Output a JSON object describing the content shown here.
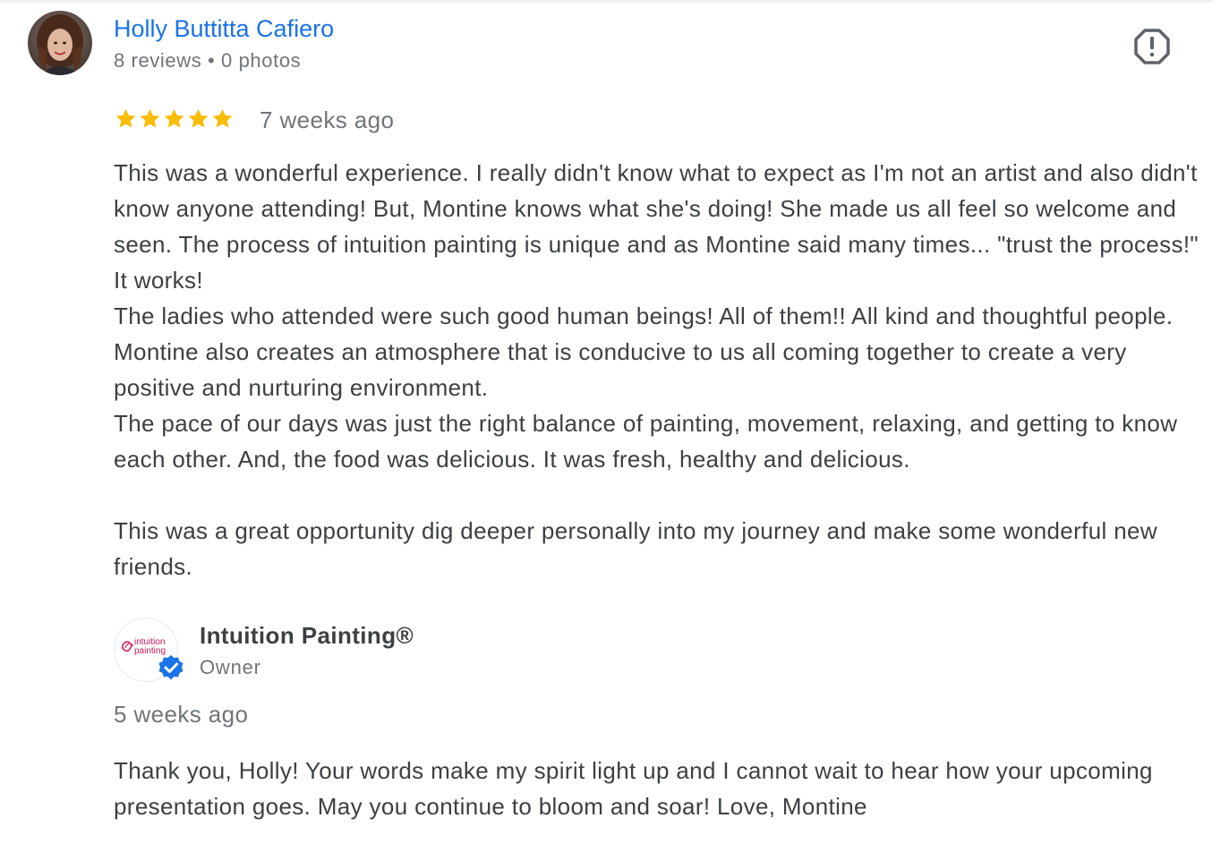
{
  "review": {
    "reviewer": {
      "name": "Holly Buttitta Cafiero",
      "meta": "8 reviews • 0 photos",
      "avatar_icon": "reviewer-photo-avatar"
    },
    "flag_icon": "report-flag-icon",
    "rating": {
      "value": 5,
      "max": 5,
      "star_color": "#fbbc04"
    },
    "time": "7 weeks ago",
    "paragraphs": [
      "This was a wonderful experience. I really didn't know what to expect as I'm not an artist and also didn't know anyone attending! But, Montine knows what she's doing! She made us all feel so welcome and seen. The process of intuition painting is unique and as Montine said many times... \"trust the process!\" It works!",
      "The ladies who attended were such good human beings! All of them!! All kind and thoughtful people. Montine also creates an atmosphere that is conducive to us all coming together to create a very positive and nurturing environment.",
      "The pace of our days was just the right balance of painting, movement, relaxing, and getting to know each other. And, the food was delicious. It was fresh, healthy and delicious.",
      "",
      "This was a great opportunity dig deeper personally into my journey and make some wonderful new friends."
    ],
    "owner_reply": {
      "name": "Intuition Painting®",
      "role": "Owner",
      "logo_text_line1": "intuition",
      "logo_text_line2": "painting",
      "verified_icon": "verified-check-icon",
      "verified_color": "#1a73e8",
      "time": "5 weeks ago",
      "text": "Thank you, Holly! Your words make my spirit light up and I cannot wait to hear how your upcoming presentation goes. May you continue to bloom and soar! Love, Montine"
    }
  },
  "colors": {
    "link_blue": "#1a73e8",
    "text_primary": "#3c4043",
    "text_secondary": "#70757a",
    "star_yellow": "#fbbc04",
    "logo_pink": "#c2185b"
  }
}
